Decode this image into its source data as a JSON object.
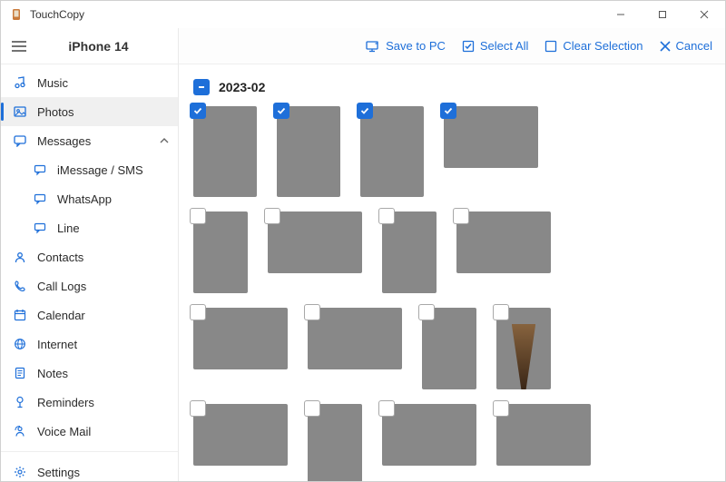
{
  "app": {
    "title": "TouchCopy"
  },
  "device": {
    "name": "iPhone 14"
  },
  "sidebar": {
    "items": [
      {
        "label": "Music"
      },
      {
        "label": "Photos"
      },
      {
        "label": "Messages"
      },
      {
        "label": "iMessage / SMS"
      },
      {
        "label": "WhatsApp"
      },
      {
        "label": "Line"
      },
      {
        "label": "Contacts"
      },
      {
        "label": "Call Logs"
      },
      {
        "label": "Calendar"
      },
      {
        "label": "Internet"
      },
      {
        "label": "Notes"
      },
      {
        "label": "Reminders"
      },
      {
        "label": "Voice Mail"
      },
      {
        "label": "Settings"
      }
    ]
  },
  "toolbar": {
    "save": "Save to PC",
    "select_all": "Select All",
    "clear": "Clear Selection",
    "cancel": "Cancel"
  },
  "group": {
    "title": "2023-02"
  },
  "photos": [
    {
      "id": "p1",
      "selected": true
    },
    {
      "id": "p2",
      "selected": true
    },
    {
      "id": "p3",
      "selected": true
    },
    {
      "id": "p4",
      "selected": true
    },
    {
      "id": "p5",
      "selected": false
    },
    {
      "id": "p6",
      "selected": false
    },
    {
      "id": "p7",
      "selected": false
    },
    {
      "id": "p8",
      "selected": false
    },
    {
      "id": "p9",
      "selected": false
    },
    {
      "id": "p10",
      "selected": false
    },
    {
      "id": "p11",
      "selected": false
    },
    {
      "id": "p12",
      "selected": false
    },
    {
      "id": "p13",
      "selected": false
    },
    {
      "id": "p14",
      "selected": false
    },
    {
      "id": "p15",
      "selected": false
    },
    {
      "id": "p16",
      "selected": false
    }
  ],
  "colors": {
    "accent": "#1e6fd9"
  }
}
